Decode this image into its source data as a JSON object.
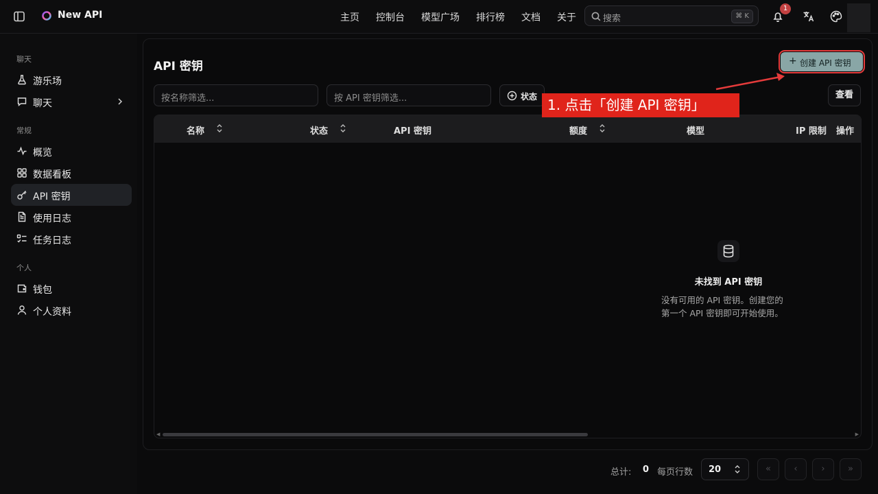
{
  "header": {
    "app_title": "New API",
    "nav": [
      "主页",
      "控制台",
      "模型广场",
      "排行榜",
      "文档",
      "关于"
    ],
    "search_placeholder": "搜索",
    "search_shortcut": "⌘ K",
    "notification_count": "1"
  },
  "sidebar": {
    "sections": [
      {
        "label": "聊天",
        "items": [
          {
            "label": "游乐场",
            "icon": "flask-icon"
          },
          {
            "label": "聊天",
            "icon": "chat-icon",
            "has_chevron": true
          }
        ]
      },
      {
        "label": "常规",
        "items": [
          {
            "label": "概览",
            "icon": "activity-icon"
          },
          {
            "label": "数据看板",
            "icon": "dashboard-icon"
          },
          {
            "label": "API 密钥",
            "icon": "key-icon",
            "active": true
          },
          {
            "label": "使用日志",
            "icon": "file-text-icon"
          },
          {
            "label": "任务日志",
            "icon": "list-check-icon"
          }
        ]
      },
      {
        "label": "个人",
        "items": [
          {
            "label": "钱包",
            "icon": "wallet-icon"
          },
          {
            "label": "个人资料",
            "icon": "user-icon"
          }
        ]
      }
    ]
  },
  "main": {
    "title": "API 密钥",
    "create_button": "创建 API 密钥",
    "filter_name_placeholder": "按名称筛选...",
    "filter_key_placeholder": "按 API 密钥筛选...",
    "status_button": "状态",
    "view_button": "查看",
    "callout": "1. 点击「创建 API 密钥」",
    "columns": [
      "名称",
      "状态",
      "API 密钥",
      "额度",
      "模型",
      "IP 限制",
      "操作"
    ],
    "empty_title": "未找到 API 密钥",
    "empty_desc_line1": "没有可用的 API 密钥。创建您的",
    "empty_desc_line2": "第一个 API 密钥即可开始使用。"
  },
  "pagination": {
    "total_label": "总计:",
    "total": "0",
    "rows_label": "每页行数",
    "page_size": "20"
  },
  "colors": {
    "accent": "#89a6a6",
    "callout": "#e0241b",
    "highlight_border": "#e53b3b"
  }
}
